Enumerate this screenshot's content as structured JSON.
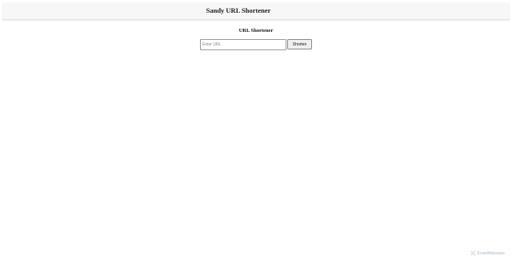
{
  "header": {
    "title": "Sandy URL Shortener"
  },
  "main": {
    "section_title": "URL Shortener",
    "url_input": {
      "value": "",
      "placeholder": "Enter URL"
    },
    "shorten_label": "Shorten"
  },
  "watermark": {
    "text": "ScanMalware",
    "icon": "scanmalware-logo-icon"
  },
  "colors": {
    "header_bg": "#f7f7f7",
    "button_bg": "#efefef",
    "watermark": "#c3ccd8"
  }
}
